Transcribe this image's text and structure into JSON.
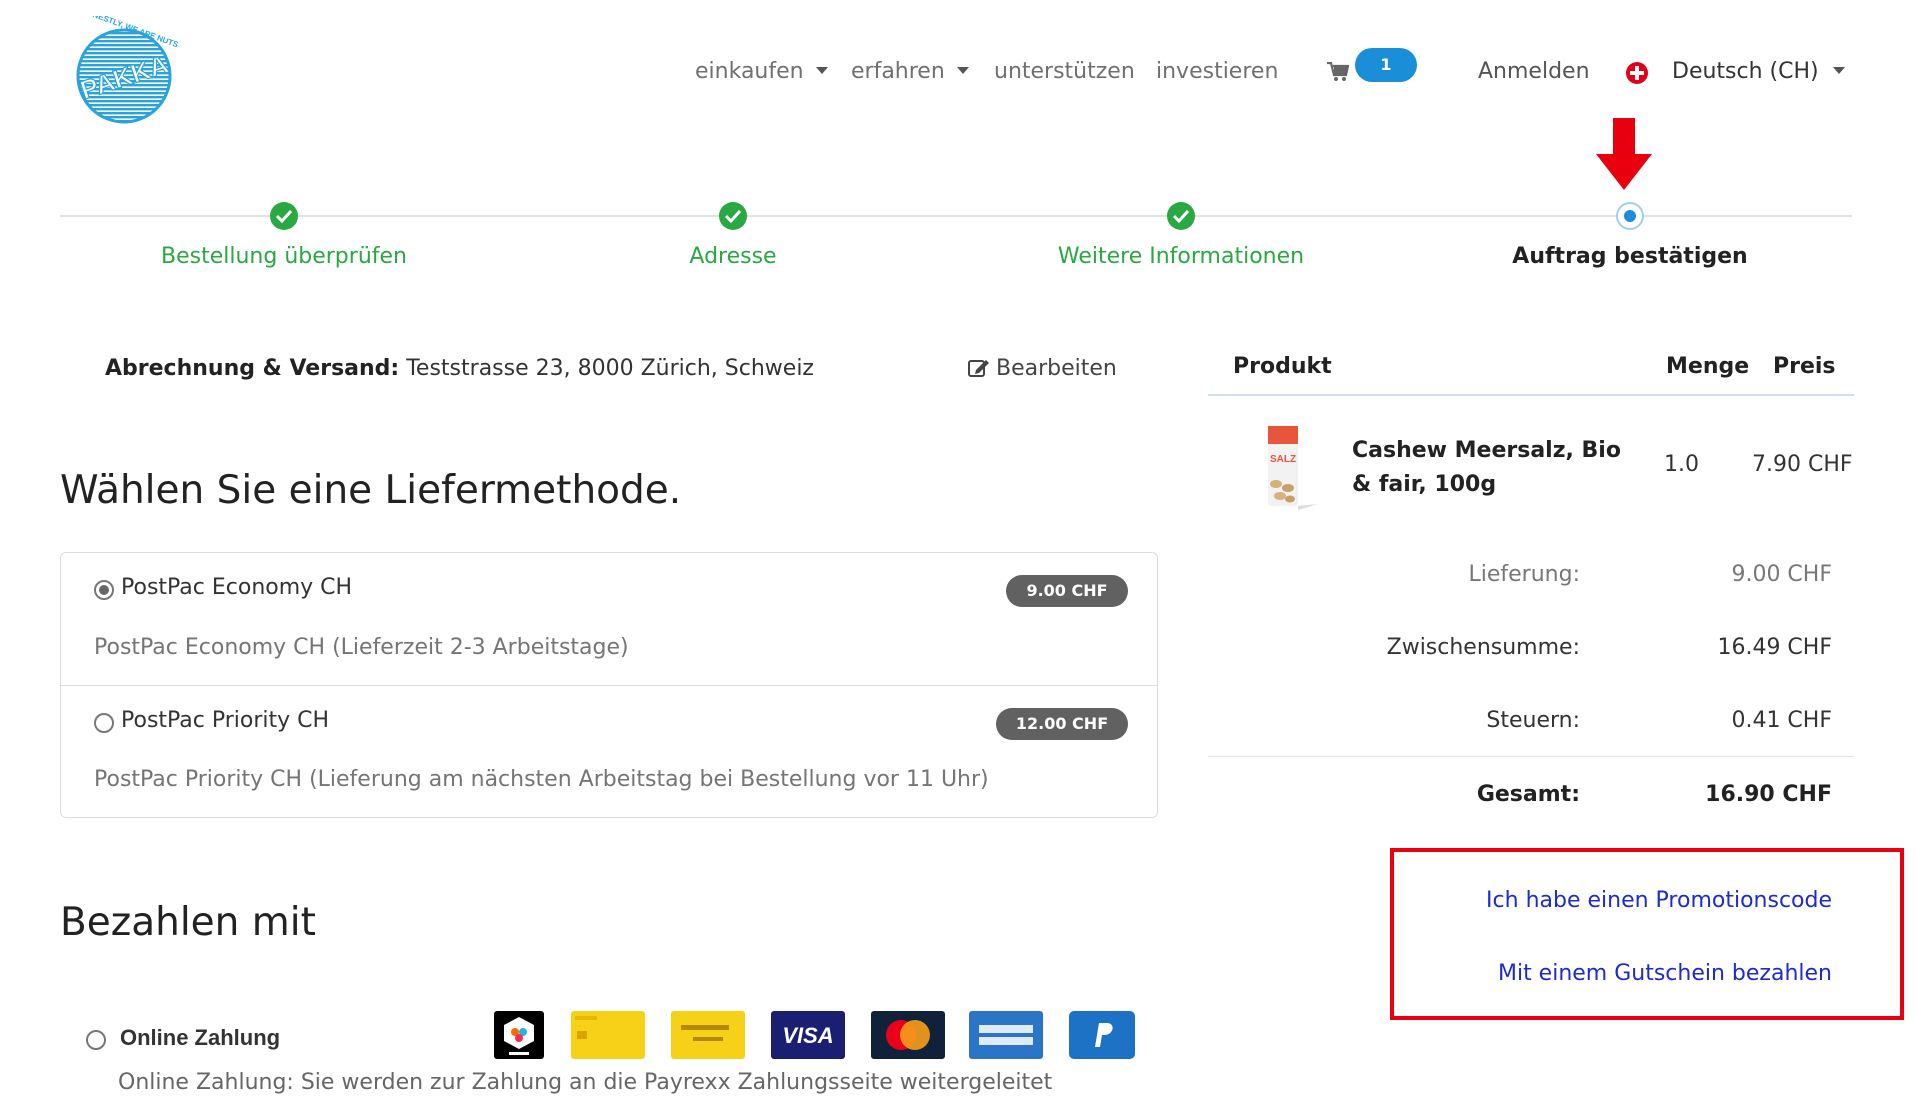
{
  "header": {
    "logo_alt": "PAKKA",
    "nav": [
      {
        "label": "einkaufen",
        "dropdown": true
      },
      {
        "label": "erfahren",
        "dropdown": true
      },
      {
        "label": "unterstützen",
        "dropdown": false
      },
      {
        "label": "investieren",
        "dropdown": false
      }
    ],
    "cart_count": "1",
    "login": "Anmelden",
    "language": "Deutsch (CH)"
  },
  "steps": [
    {
      "label": "Bestellung überprüfen",
      "state": "done"
    },
    {
      "label": "Adresse",
      "state": "done"
    },
    {
      "label": "Weitere Informationen",
      "state": "done"
    },
    {
      "label": "Auftrag bestätigen",
      "state": "current"
    }
  ],
  "billing": {
    "label": "Abrechnung & Versand:",
    "address": "Teststrasse 23, 8000 Zürich, Schweiz",
    "edit": "Bearbeiten"
  },
  "delivery": {
    "title": "Wählen Sie eine Liefermethode.",
    "options": [
      {
        "name": "PostPac Economy CH",
        "price": "9.00 CHF",
        "desc": "PostPac Economy CH (Lieferzeit 2-3 Arbeitstage)",
        "selected": true
      },
      {
        "name": "PostPac Priority CH",
        "price": "12.00 CHF",
        "desc": "PostPac Priority CH (Lieferung am nächsten Arbeitstag bei Bestellung vor 11 Uhr)",
        "selected": false
      }
    ]
  },
  "payment": {
    "title": "Bezahlen mit",
    "option_label": "Online Zahlung",
    "option_desc": "Online Zahlung: Sie werden zur Zahlung an die Payrexx Zahlungsseite weitergeleitet",
    "logos": [
      "twint",
      "postfinance-card",
      "postfinance-efinance",
      "visa",
      "mastercard",
      "american-express",
      "paypal"
    ]
  },
  "summary": {
    "col_product": "Produkt",
    "col_qty": "Menge",
    "col_price": "Preis",
    "product_name": "Cashew Meersalz, Bio & fair, 100g",
    "product_qty": "1.0",
    "product_price": "7.90 CHF",
    "delivery_label": "Lieferung:",
    "delivery_value": "9.00 CHF",
    "subtotal_label": "Zwischensumme:",
    "subtotal_value": "16.49 CHF",
    "tax_label": "Steuern:",
    "tax_value": "0.41 CHF",
    "total_label": "Gesamt:",
    "total_value": "16.90 CHF",
    "promo_link": "Ich habe einen Promotionscode",
    "voucher_link": "Mit einem Gutschein bezahlen"
  },
  "colors": {
    "success": "#2aa841",
    "primary": "#1b8ed8",
    "link": "#1d2bd0",
    "annotation": "#e8000f"
  }
}
